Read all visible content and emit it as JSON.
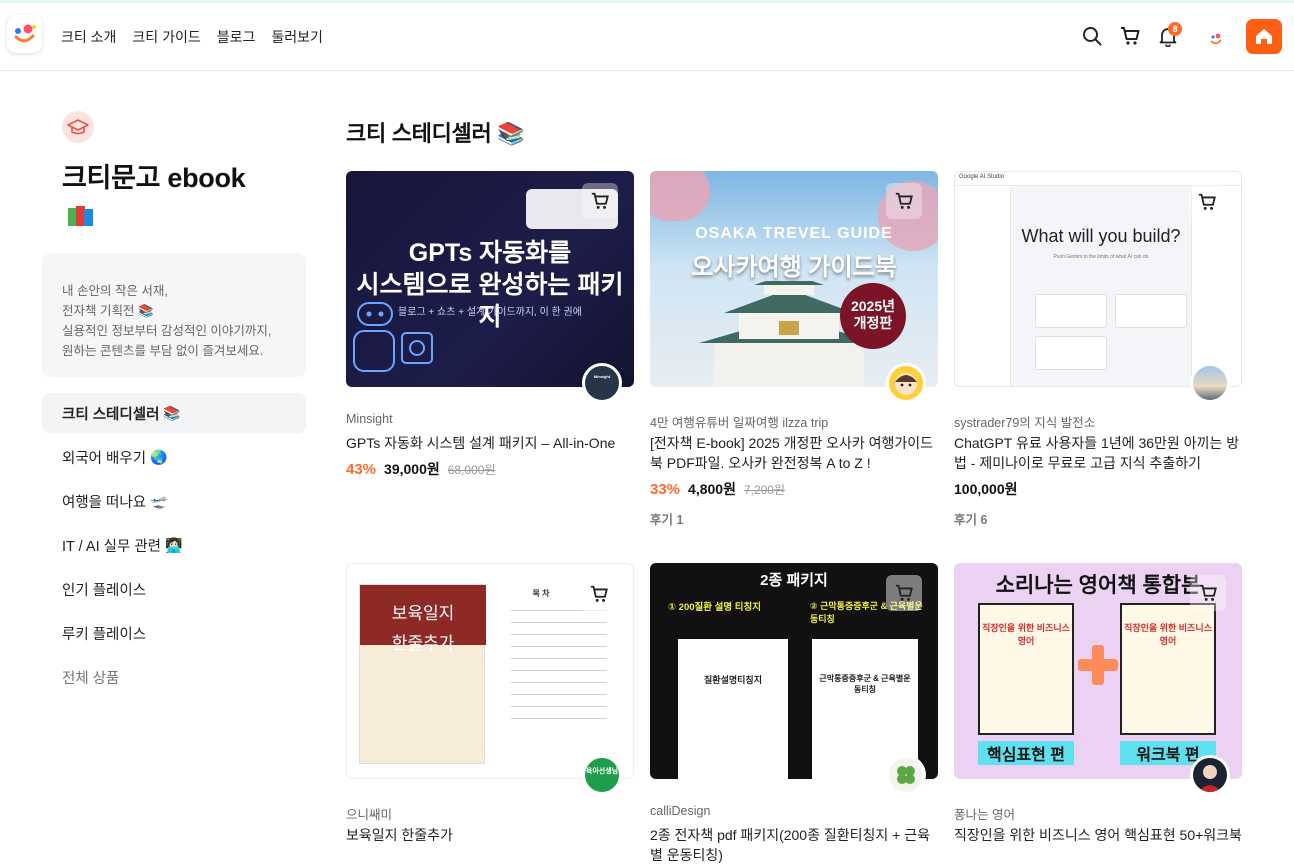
{
  "header": {
    "nav": [
      "크티 소개",
      "크티 가이드",
      "블로그",
      "둘러보기"
    ],
    "notification_count": "8"
  },
  "sidebar": {
    "title": "크티문고 ebook",
    "intro_lines": [
      "내 손안의 작은 서재,",
      "전자책 기획전 📚",
      "실용적인 정보부터 감성적인 이야기까지,",
      "원하는 콘텐츠를 부담 없이 즐겨보세요."
    ],
    "menu": [
      {
        "label": "크티 스테디셀러",
        "emoji": "📚"
      },
      {
        "label": "외국어 배우기",
        "emoji": "🌏"
      },
      {
        "label": "여행을 떠나요",
        "emoji": "🛫"
      },
      {
        "label": "IT / AI 실무 관련",
        "emoji": "👩🏻‍💻"
      },
      {
        "label": "인기 플레이스",
        "emoji": ""
      },
      {
        "label": "루키 플레이스",
        "emoji": ""
      },
      {
        "label": "전체 상품",
        "emoji": ""
      }
    ]
  },
  "main": {
    "section_title": "크티 스테디셀러 📚",
    "products": [
      {
        "seller": "Minsight",
        "title": "GPTs 자동화 시스템 설계 패키지 – All-in-One",
        "discount": "43%",
        "price": "39,000원",
        "original": "68,000원",
        "reviews": "",
        "thumb_title": "GPTs 자동화를\n시스템으로 완성하는 패키지",
        "thumb_sub": "블로그 + 쇼츠 + 설계 가이드까지, 이 한 권에",
        "avatar_text": "Minsight"
      },
      {
        "seller": "4만 여행유튜버 일짜여행 ilzza trip",
        "title": "[전자책 E-book] 2025 개정판 오사카 여행가이드북 PDF파일. 오사카 완전정복 A to Z !",
        "discount": "33%",
        "price": "4,800원",
        "original": "7,200원",
        "reviews": "후기 1",
        "thumb_title": "OSAKA TREVEL GUIDE",
        "thumb_sub": "오사카여행 가이드북",
        "badge": "2025년\n개정판"
      },
      {
        "seller": "systrader79의 지식 발전소",
        "title": "ChatGPT 유료 사용자들 1년에 36만원 아끼는 방법 - 제미나이로 무료로 고급 지식 추출하기",
        "discount": "",
        "price": "100,000원",
        "original": "",
        "reviews": "후기 6",
        "thumb_title": "What will you build?",
        "thumb_sub": "Push Gemini to the limits of what AI can do",
        "app_name": "Google AI Studio"
      },
      {
        "seller": "으니쌔미",
        "title": "보육일지 한줄추가",
        "thumb_title": "보육일지\n한줄추가",
        "thumb_sub": "목 차",
        "avatar_text": "육아선생님"
      },
      {
        "seller": "calliDesign",
        "title": "2종 전자책 pdf 패키지(200종 질환티칭지 + 근육별 운동티칭)",
        "thumb_title": "2종 패키지",
        "thumb_sub1": "① 200질환 설명 티칭지",
        "thumb_sub2": "② 근막통증증후군 & 근육별운동티칭",
        "thumb_doc1": "질환설명티칭지",
        "thumb_doc2": "근막통증증후군 & 근육별운동티칭"
      },
      {
        "seller": "퐁나는 영어",
        "title": "직장인을 위한 비즈니스 영어 핵심표현 50+워크북",
        "thumb_title": "소리나는 영어책 통합본",
        "thumb_sub1": "핵심표현 편",
        "thumb_sub2": "워크북 편",
        "book_title": "직장인을 위한 비즈니스 영어"
      }
    ]
  },
  "colors": {
    "accent": "#ff6b2c",
    "home_button": "#ff5f14"
  },
  "icons": [
    "search-icon",
    "cart-icon",
    "bell-icon",
    "home-icon",
    "graduation-cap-icon",
    "books-icon"
  ]
}
